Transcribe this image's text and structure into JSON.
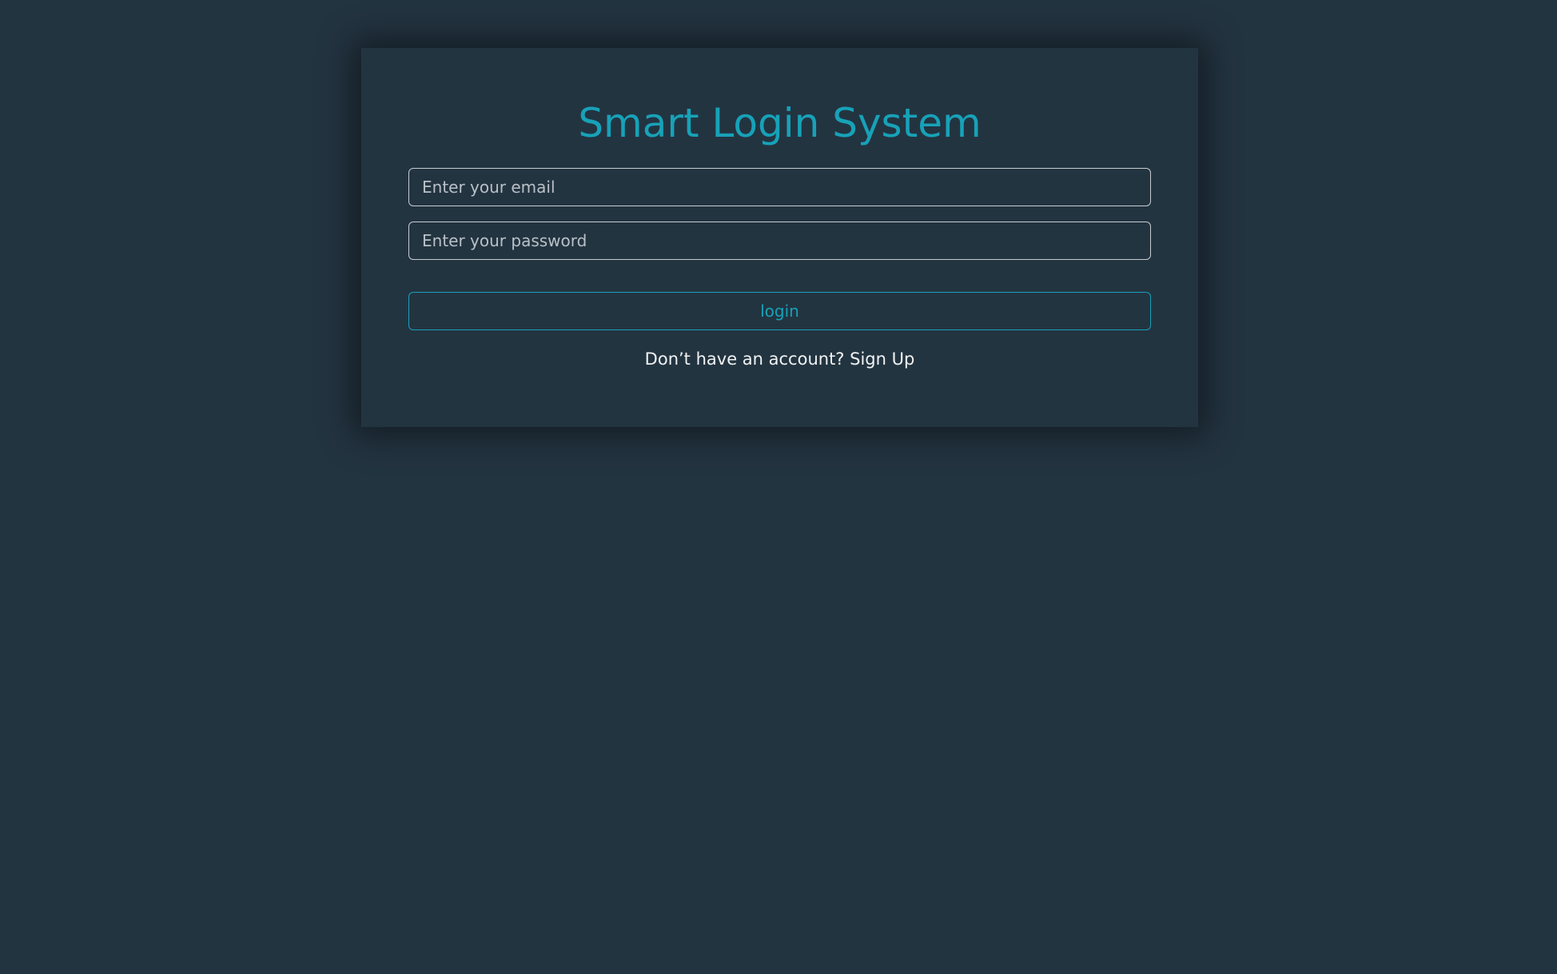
{
  "login": {
    "title": "Smart Login System",
    "email_placeholder": "Enter your email",
    "password_placeholder": "Enter your password",
    "login_label": "login",
    "signup_prompt": "Don’t have an account?",
    "signup_label": "Sign Up"
  },
  "colors": {
    "background": "#233441",
    "accent": "#17a2b8",
    "text": "#f1f3f4",
    "field_border": "#c7ccd1"
  }
}
